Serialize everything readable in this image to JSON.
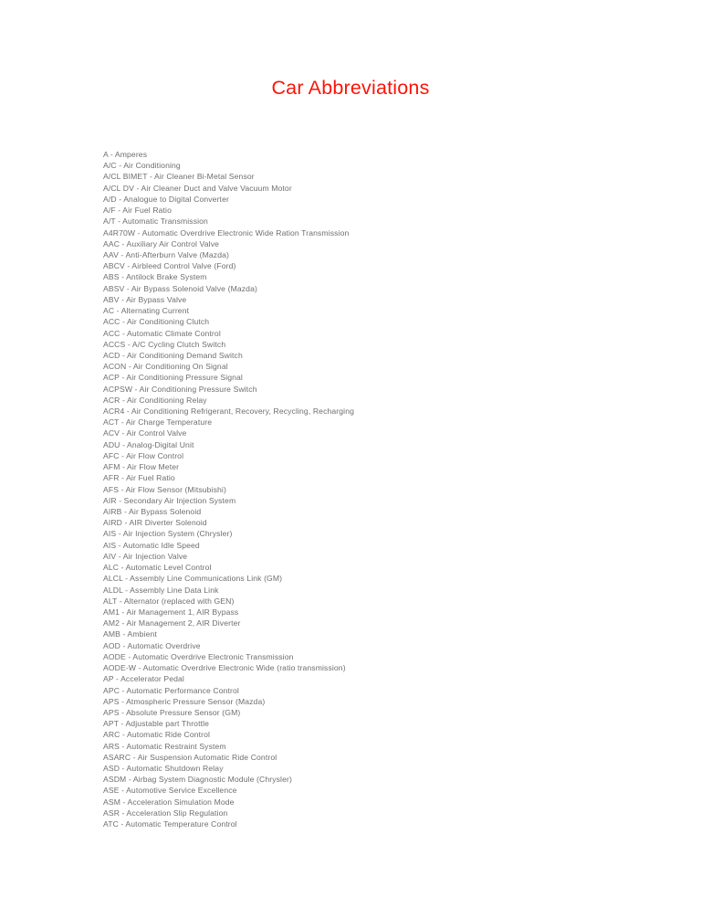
{
  "document": {
    "title": "Car Abbreviations",
    "title_color": "#fa1408",
    "body_text_color": "#6e6e70",
    "background_color": "#ffffff",
    "entries": [
      "A - Amperes",
      "A/C - Air Conditioning",
      "A/CL BIMET - Air Cleaner Bi-Metal Sensor",
      "A/CL DV - Air Cleaner Duct and Valve Vacuum Motor",
      "A/D - Analogue to Digital Converter",
      "A/F - Air Fuel Ratio",
      "A/T - Automatic Transmission",
      "A4R70W - Automatic Overdrive Electronic Wide Ration Transmission",
      "AAC - Auxiliary Air Control Valve",
      "AAV - Anti-Afterburn Valve (Mazda)",
      "ABCV - Airbleed Control Valve (Ford)",
      "ABS - Antilock Brake System",
      "ABSV - Air Bypass Solenoid Valve (Mazda)",
      "ABV - Air Bypass Valve",
      "AC - Alternating Current",
      "ACC - Air Conditioning Clutch",
      "ACC - Automatic Climate Control",
      "ACCS - A/C Cycling Clutch Switch",
      "ACD - Air Conditioning Demand Switch",
      "ACON - Air Conditioning On Signal",
      "ACP - Air Conditioning Pressure Signal",
      "ACPSW - Air Conditioning Pressure Switch",
      "ACR - Air Conditioning Relay",
      "ACR4 - Air Conditioning Refrigerant, Recovery, Recycling, Recharging",
      "ACT - Air Charge Temperature",
      "ACV - Air Control Valve",
      "ADU - Analog-Digital Unit",
      "AFC - Air Flow Control",
      "AFM - Air Flow Meter",
      "AFR - Air Fuel Ratio",
      "AFS - Air Flow Sensor (Mitsubishi)",
      "AIR - Secondary Air Injection System",
      "AIRB - Air Bypass Solenoid",
      "AIRD - AIR Diverter Solenoid",
      "AIS - Air Injection System (Chrysler)",
      "AIS - Automatic Idle Speed",
      "AIV - Air Injection Valve",
      "ALC - Automatic Level Control",
      "ALCL - Assembly Line Communications Link (GM)",
      "ALDL - Assembly Line Data Link",
      "ALT - Alternator (replaced with GEN)",
      "AM1 - Air Management 1, AIR Bypass",
      "AM2 - Air Management 2, AIR Diverter",
      "AMB - Ambient",
      "AOD - Automatic Overdrive",
      "AODE - Automatic Overdrive Electronic Transmission",
      "AODE-W - Automatic Overdrive Electronic Wide (ratio transmission)",
      "AP - Accelerator Pedal",
      "APC - Automatic Performance Control",
      "APS - Atmospheric Pressure Sensor (Mazda)",
      "APS - Absolute Pressure Sensor (GM)",
      "APT - Adjustable part Throttle",
      "ARC - Automatic Ride Control",
      "ARS - Automatic Restraint System",
      "ASARC - Air Suspension Automatic Ride Control",
      "ASD - Automatic Shutdown Relay",
      "ASDM - Airbag System Diagnostic Module (Chrysler)",
      "ASE - Automotive Service Excellence",
      "ASM - Acceleration Simulation Mode",
      "ASR - Acceleration Slip Regulation",
      "ATC - Automatic Temperature Control"
    ]
  }
}
